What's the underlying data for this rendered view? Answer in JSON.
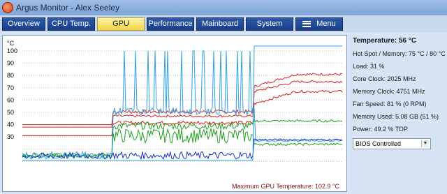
{
  "window": {
    "title": "Argus Monitor - Alex Seeley"
  },
  "tabs": [
    {
      "label": "Overview"
    },
    {
      "label": "CPU Temp."
    },
    {
      "label": "GPU"
    },
    {
      "label": "Performance"
    },
    {
      "label": "Mainboard"
    },
    {
      "label": "System"
    },
    {
      "label": "Menu"
    }
  ],
  "active_tab": "GPU",
  "chart": {
    "unit": "°C",
    "yticks": [
      "100",
      "90",
      "80",
      "70",
      "60",
      "50",
      "40",
      "30"
    ],
    "max_label": "Maximum GPU Temperature: 102.9 °C"
  },
  "stats": {
    "temperature": "Temperature: 56 °C",
    "hotspot": "Hot Spot / Memory: 75 °C / 80 °C",
    "load": "Load: 31 %",
    "core_clock": "Core Clock: 2025 MHz",
    "memory_clock": "Memory Clock: 4751 MHz",
    "fan_speed": "Fan Speed: 81 % (0 RPM)",
    "memory_used": "Memory Used: 5.08 GB (51 %)",
    "power": "Power: 49.2 % TDP"
  },
  "fan_mode": {
    "selected": "BIOS Controlled"
  },
  "colors": {
    "temp": "#d42020",
    "load": "#2fa0e0",
    "power": "#20a020",
    "clock": "#1830c0"
  }
}
